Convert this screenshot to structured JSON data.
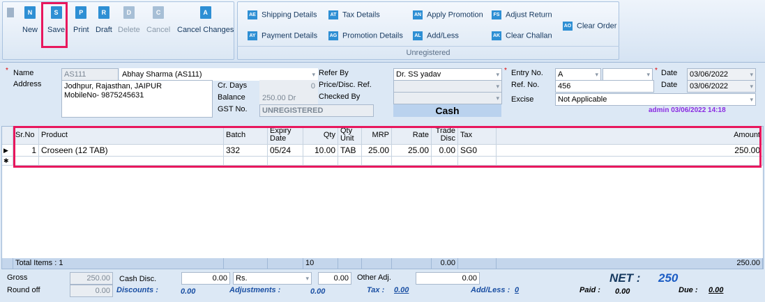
{
  "toolbar": {
    "buttons": [
      {
        "label": "New",
        "code": "N",
        "disabled": false
      },
      {
        "label": "Save",
        "code": "S",
        "disabled": false
      },
      {
        "label": "Print",
        "code": "P",
        "disabled": false
      },
      {
        "label": "Draft",
        "code": "R",
        "disabled": false
      },
      {
        "label": "Delete",
        "code": "D",
        "disabled": true
      },
      {
        "label": "Cancel",
        "code": "C",
        "disabled": true
      },
      {
        "label": "Cancel Changes",
        "code": "A",
        "disabled": false
      }
    ],
    "links": [
      {
        "label": "Shipping Details",
        "code": "AE"
      },
      {
        "label": "Tax Details",
        "code": "AT"
      },
      {
        "label": "Apply Promotion",
        "code": "AN"
      },
      {
        "label": "Adjust Return",
        "code": "FS"
      },
      {
        "label": "Clear Order",
        "code": "AO"
      },
      {
        "label": "Payment Details",
        "code": "AY"
      },
      {
        "label": "Promotion Details",
        "code": "AG"
      },
      {
        "label": "Add/Less",
        "code": "AL"
      },
      {
        "label": "Clear Challan",
        "code": "AK"
      }
    ],
    "status": "Unregistered"
  },
  "header": {
    "name_label": "Name",
    "name_code": "AS111",
    "name_value": "Abhay Sharma  (AS111)",
    "address_label": "Address",
    "address_line1": "Jodhpur, Rajasthan,  JAIPUR",
    "address_line2": "MobileNo- 9875245631",
    "cr_days_label": "Cr. Days",
    "cr_days_value": "0",
    "balance_label": "Balance",
    "balance_value": "250.00 Dr",
    "gst_label": "GST No.",
    "gst_value": "UNREGISTERED",
    "refer_by_label": "Refer By",
    "refer_by_value": "Dr. SS yadav",
    "price_disc_label": "Price/Disc. Ref.",
    "checked_by_label": "Checked By",
    "payment_mode": "Cash",
    "entry_no_label": "Entry No.",
    "entry_no_value": "A",
    "ref_no_label": "Ref. No.",
    "ref_no_value": "456",
    "excise_label": "Excise",
    "excise_value": "Not Applicable",
    "date_label": "Date",
    "date1_value": "03/06/2022",
    "date2_value": "03/06/2022",
    "admin_stamp": "admin 03/06/2022 14:18"
  },
  "grid": {
    "columns": {
      "srno": "Sr.No",
      "product": "Product",
      "batch": "Batch",
      "expiry": "Expiry Date",
      "qty": "Qty",
      "qty_unit": "Qty Unit",
      "mrp": "MRP",
      "rate": "Rate",
      "trade_disc": "Trade Disc",
      "tax": "Tax",
      "amount": "Amount"
    },
    "rows": [
      {
        "srno": "1",
        "product": "Croseen (12 TAB)",
        "batch": "332",
        "expiry": "05/24",
        "qty": "10.00",
        "unit": "TAB",
        "mrp": "25.00",
        "rate": "25.00",
        "trade_disc": "0.00",
        "tax": "SG0",
        "amount": "250.00"
      }
    ],
    "footer": {
      "total_items": "Total Items : 1",
      "qty_total": "10",
      "disc_total": "0.00",
      "amount_total": "250.00"
    }
  },
  "summary": {
    "gross_label": "Gross",
    "gross_value": "250.00",
    "cash_disc_label": "Cash Disc.",
    "cash_disc_value": "0.00",
    "cash_disc_unit": "Rs.",
    "cash_disc_amount": "0.00",
    "other_adj_label": "Other Adj.",
    "other_adj_value": "0.00",
    "round_off_label": "Round off",
    "round_off_value": "0.00",
    "discounts_label": "Discounts :",
    "discounts_value": "0.00",
    "adjustments_label": "Adjustments :",
    "adjustments_value": "0.00",
    "tax_label": "Tax :",
    "tax_value": "0.00",
    "addless_label": "Add/Less :",
    "addless_value": "0",
    "paid_label": "Paid :",
    "paid_value": "0.00",
    "due_label": "Due :",
    "due_value": "0.00",
    "net_label": "NET :",
    "net_value": "250"
  }
}
